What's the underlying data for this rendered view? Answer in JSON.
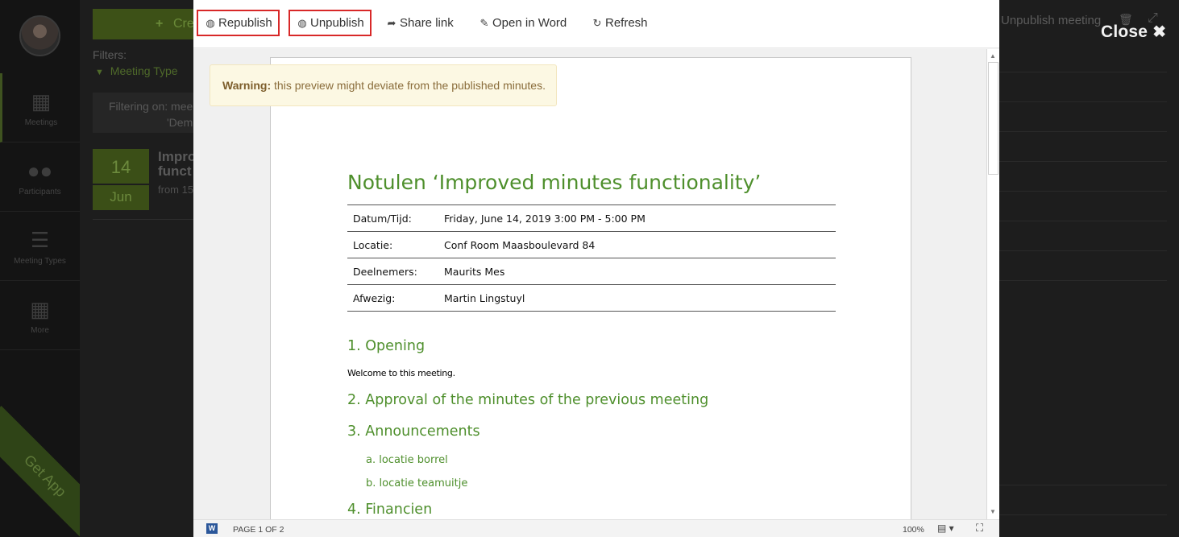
{
  "background": {
    "sidebar": {
      "items": [
        {
          "label": "Meetings",
          "icon": "calendar-icon"
        },
        {
          "label": "Participants",
          "icon": "users-icon"
        },
        {
          "label": "Meeting Types",
          "icon": "list-icon"
        },
        {
          "label": "More",
          "icon": "grid-icon"
        }
      ],
      "get_app": "Get App"
    },
    "create_label": "Cre",
    "filters_label": "Filters:",
    "filter_meeting_type": "Meeting Type",
    "filtering_on_line1": "Filtering on: mee",
    "filtering_on_line2": "'Dem",
    "meeting": {
      "day": "14",
      "month": "Jun",
      "title": "Impro funct",
      "time": "from 15"
    },
    "unpublish_meeting": "Unpublish meeting",
    "close_label": "Close"
  },
  "toolbar": {
    "republish": "Republish",
    "unpublish": "Unpublish",
    "share_link": "Share link",
    "open_in_word": "Open in Word",
    "refresh": "Refresh"
  },
  "warning": {
    "strong": "Warning:",
    "text": " this preview might deviate from the published minutes."
  },
  "document": {
    "title": "Notulen ‘Improved minutes functionality’",
    "info": [
      {
        "key": "Datum/Tijd:",
        "value": "Friday, June 14, 2019 3:00 PM - 5:00 PM"
      },
      {
        "key": "Locatie:",
        "value": "Conf Room Maasboulevard 84"
      },
      {
        "key": "Deelnemers:",
        "value": "Maurits Mes"
      },
      {
        "key": "Afwezig:",
        "value": "Martin Lingstuyl"
      }
    ],
    "section1": "1. Opening",
    "section1_body": "Welcome to this meeting.",
    "section2": "2. Approval of the minutes of the previous meeting",
    "section3": "3. Announcements",
    "section3_a": "a. locatie borrel",
    "section3_b": "b. locatie teamuitje",
    "section4": "4. Financien"
  },
  "statusbar": {
    "page_info": "PAGE 1 OF 2",
    "zoom": "100%"
  },
  "colors": {
    "accent_green": "#4e8f2c",
    "highlight_red": "#d82828",
    "warning_bg": "#fcf8e3"
  }
}
